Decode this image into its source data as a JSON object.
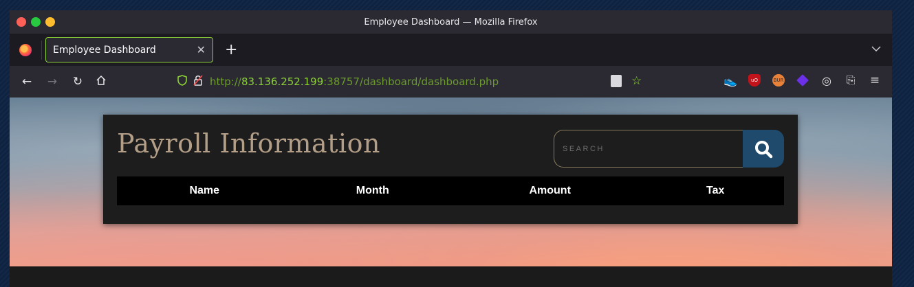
{
  "window": {
    "title": "Employee Dashboard — Mozilla Firefox"
  },
  "tabs": [
    {
      "label": "Employee Dashboard",
      "active": true
    }
  ],
  "navbar": {
    "url_prefix": "http://",
    "url_host": "83.136.252.199",
    "url_rest": ":38757/dashboard/dashboard.php"
  },
  "extensions": [
    "shoe-icon",
    "ublock-icon",
    "burp-icon",
    "diamond-icon",
    "cookie-icon",
    "extensions-icon",
    "menu-icon"
  ],
  "page": {
    "title": "Payroll Information",
    "search": {
      "placeholder": "SEARCH",
      "value": ""
    },
    "table": {
      "headers": [
        "Name",
        "Month",
        "Amount",
        "Tax"
      ],
      "rows": []
    }
  },
  "colors": {
    "accent": "#8cd234",
    "panel": "#1d1d1d",
    "title": "#b39e87",
    "search_button": "#1f4a6b"
  }
}
